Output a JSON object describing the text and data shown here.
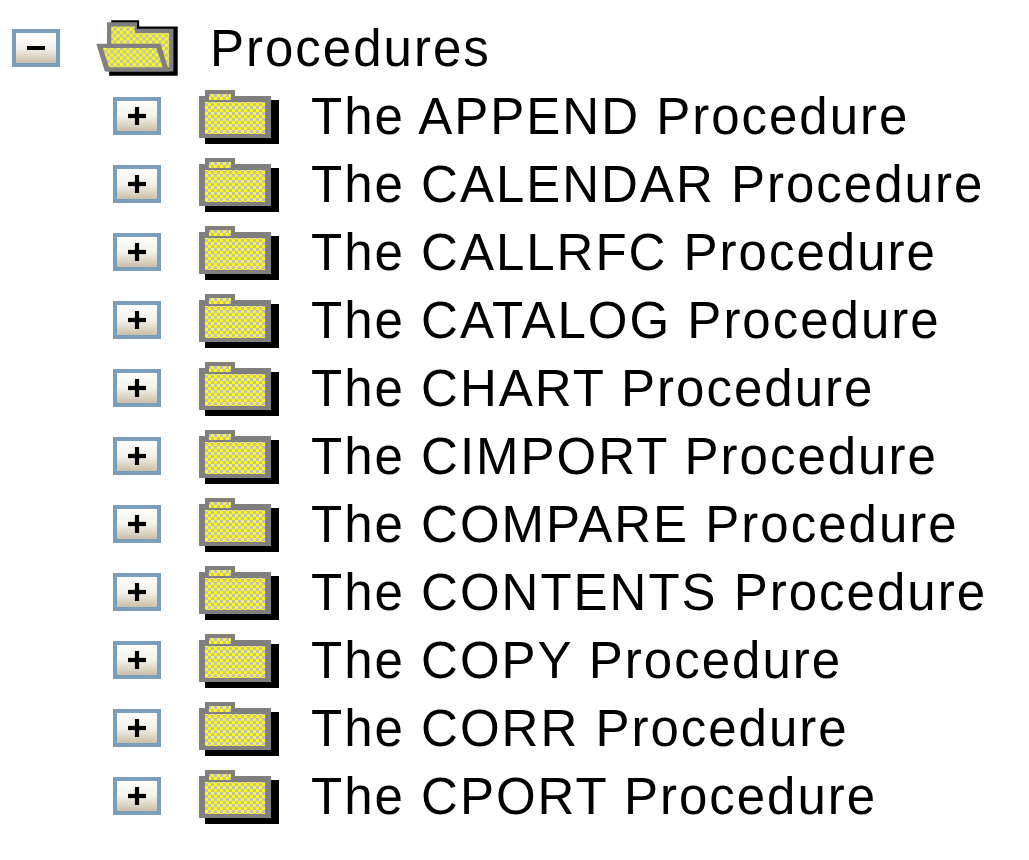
{
  "tree": [
    {
      "label": "Procedures",
      "expanded": true,
      "children": [
        {
          "label": "The APPEND Procedure",
          "expanded": false
        },
        {
          "label": "The CALENDAR Procedure",
          "expanded": false
        },
        {
          "label": "The CALLRFC Procedure",
          "expanded": false
        },
        {
          "label": "The CATALOG Procedure",
          "expanded": false
        },
        {
          "label": "The CHART Procedure",
          "expanded": false
        },
        {
          "label": "The CIMPORT Procedure",
          "expanded": false
        },
        {
          "label": "The COMPARE Procedure",
          "expanded": false
        },
        {
          "label": "The CONTENTS Procedure",
          "expanded": false
        },
        {
          "label": "The COPY Procedure",
          "expanded": false
        },
        {
          "label": "The CORR Procedure",
          "expanded": false
        },
        {
          "label": "The CPORT Procedure",
          "expanded": false
        }
      ]
    }
  ]
}
